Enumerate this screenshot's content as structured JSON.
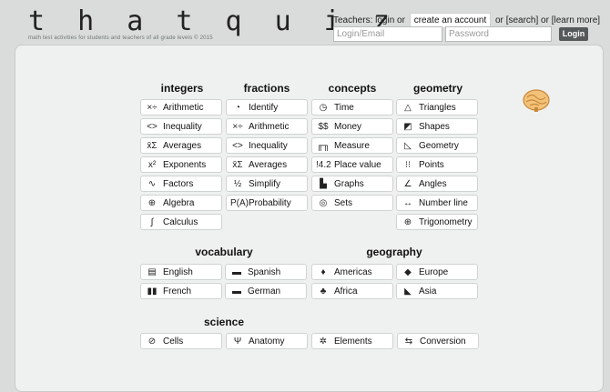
{
  "header": {
    "logo": "t h a t  q u i z",
    "tagline": "math test activities for students and teachers of all grade levels © 2015",
    "teachers_prefix": "Teachers: login or",
    "create_account": "create an account",
    "or1": "or",
    "search": "[search]",
    "or2": "or",
    "learn_more": "[learn more]",
    "login_placeholder": "Login/Email",
    "password_placeholder": "Password",
    "login_button": "Login"
  },
  "sections": {
    "integers": {
      "title": "integers",
      "items": [
        {
          "icon": "×÷",
          "label": "Arithmetic"
        },
        {
          "icon": "<>",
          "label": "Inequality"
        },
        {
          "icon": "x̄Σ",
          "label": "Averages"
        },
        {
          "icon": "x²",
          "label": "Exponents"
        },
        {
          "icon": "∿",
          "label": "Factors"
        },
        {
          "icon": "⊕",
          "label": "Algebra"
        },
        {
          "icon": "∫",
          "label": "Calculus"
        }
      ]
    },
    "fractions": {
      "title": "fractions",
      "items": [
        {
          "icon": "◔",
          "label": "Identify"
        },
        {
          "icon": "×÷",
          "label": "Arithmetic"
        },
        {
          "icon": "<>",
          "label": "Inequality"
        },
        {
          "icon": "x̄Σ",
          "label": "Averages"
        },
        {
          "icon": "½",
          "label": "Simplify"
        },
        {
          "icon": "P(A)",
          "label": "Probability"
        }
      ]
    },
    "concepts": {
      "title": "concepts",
      "items": [
        {
          "icon": "◷",
          "label": "Time"
        },
        {
          "icon": "$$",
          "label": "Money"
        },
        {
          "icon": "╓╖",
          "label": "Measure"
        },
        {
          "icon": "!4.2",
          "label": "Place value"
        },
        {
          "icon": "▙",
          "label": "Graphs"
        },
        {
          "icon": "◎",
          "label": "Sets"
        }
      ]
    },
    "geometry": {
      "title": "geometry",
      "items": [
        {
          "icon": "△",
          "label": "Triangles"
        },
        {
          "icon": "◩",
          "label": "Shapes"
        },
        {
          "icon": "◺",
          "label": "Geometry"
        },
        {
          "icon": "⁝⁝",
          "label": "Points"
        },
        {
          "icon": "∠",
          "label": "Angles"
        },
        {
          "icon": "↔",
          "label": "Number line"
        },
        {
          "icon": "⊕",
          "label": "Trigonometry"
        }
      ]
    },
    "vocabulary": {
      "title": "vocabulary",
      "items": [
        {
          "icon": "▤",
          "label": "English"
        },
        {
          "icon": "▬",
          "label": "Spanish"
        },
        {
          "icon": "▮▮",
          "label": "French"
        },
        {
          "icon": "▬",
          "label": "German"
        }
      ]
    },
    "geography": {
      "title": "geography",
      "items": [
        {
          "icon": "♦",
          "label": "Americas"
        },
        {
          "icon": "◆",
          "label": "Europe"
        },
        {
          "icon": "♣",
          "label": "Africa"
        },
        {
          "icon": "◣",
          "label": "Asia"
        }
      ]
    },
    "science": {
      "title": "science",
      "items": [
        {
          "icon": "⊘",
          "label": "Cells"
        },
        {
          "icon": "Ψ",
          "label": "Anatomy"
        },
        {
          "icon": "✲",
          "label": "Elements"
        },
        {
          "icon": "⇆",
          "label": "Conversion"
        }
      ]
    }
  }
}
